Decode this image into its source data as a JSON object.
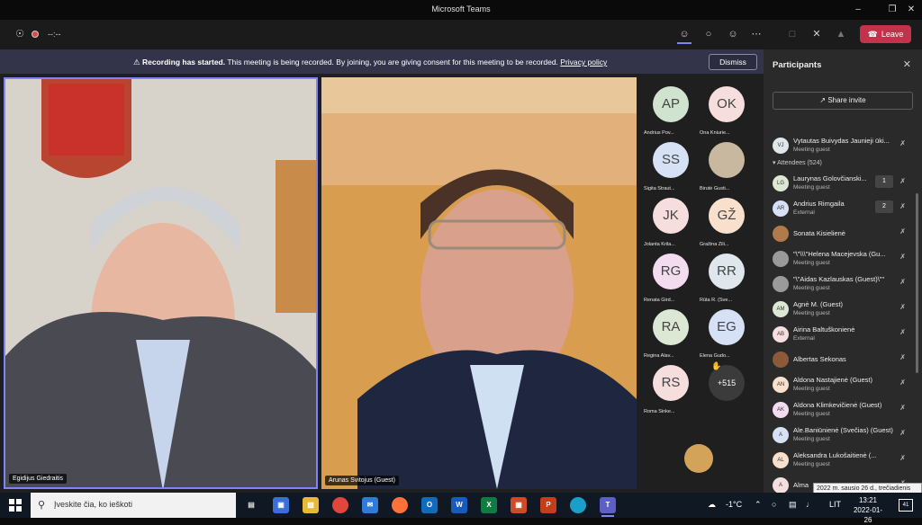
{
  "window": {
    "title": "Microsoft Teams"
  },
  "toolbar": {
    "timer": "--:--",
    "leave_label": "Leave"
  },
  "banner": {
    "bold": "Recording has started.",
    "text": "This meeting is being recorded. By joining, you are giving consent for this meeting to be recorded.",
    "link": "Privacy policy",
    "dismiss_label": "Dismiss"
  },
  "videos": [
    {
      "name": "Egidijus Giedraitis"
    },
    {
      "name": "Arunas Svitojus (Guest)"
    }
  ],
  "gallery": [
    {
      "initials": "AP",
      "name": "Andrius Pov...",
      "color": "#cfe3cf"
    },
    {
      "initials": "OK",
      "name": "Ona Kniurie...",
      "color": "#f6dede"
    },
    {
      "initials": "SS",
      "name": "Sigita Straut...",
      "color": "#d6e1f5"
    },
    {
      "initials": "",
      "name": "Birutė Gusti...",
      "color": "#c9b8a0"
    },
    {
      "initials": "JK",
      "name": "Jolanta Krila...",
      "color": "#f6dede"
    },
    {
      "initials": "GŽ",
      "name": "Gražina Žili...",
      "color": "#f8e0cc"
    },
    {
      "initials": "RG",
      "name": "Renata Gird...",
      "color": "#f3dcef"
    },
    {
      "initials": "RR",
      "name": "Rūta R. (Sve...",
      "color": "#dfe7ec"
    },
    {
      "initials": "RA",
      "name": "Regina Alav...",
      "color": "#dde8d4"
    },
    {
      "initials": "EG",
      "name": "Elena Gudo...",
      "color": "#d6e1f5"
    },
    {
      "initials": "RS",
      "name": "Roma Sinke...",
      "color": "#f6dede"
    }
  ],
  "gallery_more": "+515",
  "panel": {
    "title": "Participants",
    "share_label": "Share invite",
    "presenter": {
      "initials": "VJ",
      "name": "Vytautas Buivydas Jaunieji ūki...",
      "role": "Meeting guest",
      "color": "#dfe7ec"
    },
    "attendees_label": "Attendees (524)",
    "attendees": [
      {
        "initials": "LG",
        "name": "Laurynas Golovčianski...",
        "role": "Meeting guest",
        "color": "#dde8d4",
        "hand": "1"
      },
      {
        "initials": "AR",
        "name": "Andrius Rimgaila",
        "role": "External",
        "color": "#d6e1f5",
        "hand": "2"
      },
      {
        "initials": "",
        "name": "Sonata Kisielienė",
        "role": "",
        "color": "#b07a4a",
        "hand": ""
      },
      {
        "initials": "",
        "name": "\"\\\"\\\\\\\"Helena Macejevska (Gu...",
        "role": "Meeting guest",
        "color": "#9a9a9a",
        "hand": ""
      },
      {
        "initials": "",
        "name": "\"\\\"Aidas Kazlauskas (Guest)\\\"\"",
        "role": "Meeting guest",
        "color": "#9a9a9a",
        "hand": ""
      },
      {
        "initials": "AM",
        "name": "Agnė M. (Guest)",
        "role": "Meeting guest",
        "color": "#dde8d4",
        "hand": ""
      },
      {
        "initials": "AB",
        "name": "Airina Baltuškonienė",
        "role": "External",
        "color": "#f6dede",
        "hand": ""
      },
      {
        "initials": "",
        "name": "Albertas Sekonas",
        "role": "",
        "color": "#8a5a3a",
        "hand": ""
      },
      {
        "initials": "AN",
        "name": "Aldona Nastajienė (Guest)",
        "role": "Meeting guest",
        "color": "#f8e0cc",
        "hand": ""
      },
      {
        "initials": "AK",
        "name": "Aldona Klimkevičienė (Guest)",
        "role": "Meeting guest",
        "color": "#f3dcef",
        "hand": ""
      },
      {
        "initials": "A",
        "name": "Ale.Baniūnienė (Svečias) (Guest)",
        "role": "Meeting guest",
        "color": "#d6e1f5",
        "hand": ""
      },
      {
        "initials": "AL",
        "name": "Aleksandra Lukošaitienė (...",
        "role": "Meeting guest",
        "color": "#f8e0cc",
        "hand": ""
      },
      {
        "initials": "A",
        "name": "Alma",
        "role": "",
        "color": "#f6dede",
        "hand": ""
      }
    ]
  },
  "tooltip": "2022 m. sausio 26 d., trečiadienis",
  "taskbar": {
    "search_placeholder": "Įveskite čia, ko ieškoti",
    "weather": "-1°C",
    "lang": "LIT",
    "time": "13:21",
    "date": "2022-01-26",
    "notifications": "41",
    "apps": [
      {
        "label": "O",
        "color": "#0f6cbd",
        "name": "outlook"
      },
      {
        "label": "W",
        "color": "#185abd",
        "name": "word"
      },
      {
        "label": "X",
        "color": "#107c41",
        "name": "excel"
      },
      {
        "label": "P",
        "color": "#c43e1c",
        "name": "powerpoint"
      }
    ]
  }
}
